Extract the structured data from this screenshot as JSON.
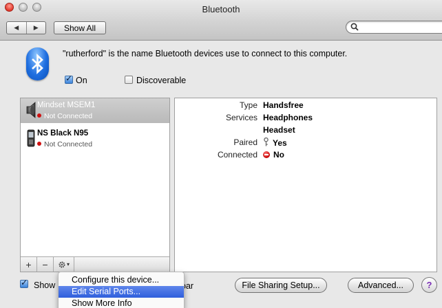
{
  "window": {
    "title": "Bluetooth"
  },
  "toolbar": {
    "back_symbol": "◀",
    "forward_symbol": "▶",
    "show_all": "Show All",
    "search_placeholder": ""
  },
  "header": {
    "description": "\"rutherford\" is the name Bluetooth devices use to connect to this computer.",
    "on_label": "On",
    "on_checked": true,
    "discoverable_label": "Discoverable",
    "discoverable_checked": false
  },
  "devices": [
    {
      "name": "Mindset MSEM1",
      "status": "Not Connected",
      "icon": "speaker-icon",
      "selected": true
    },
    {
      "name": "NS Black N95",
      "status": "Not Connected",
      "icon": "phone-icon",
      "selected": false
    }
  ],
  "list_bar": {
    "add": "+",
    "remove": "−",
    "gear_arrow": "▾"
  },
  "details": {
    "type_label": "Type",
    "type_value": "Handsfree",
    "services_label": "Services",
    "services_value_1": "Headphones",
    "services_value_2": "Headset",
    "paired_label": "Paired",
    "paired_value": "Yes",
    "connected_label": "Connected",
    "connected_value": "No"
  },
  "bottom": {
    "show_label": "Show",
    "bar_label": "bar",
    "show_checked": true,
    "file_sharing": "File Sharing Setup...",
    "advanced": "Advanced...",
    "help": "?"
  },
  "menu": {
    "items": [
      "Configure this device...",
      "Edit Serial Ports...",
      "Show More Info"
    ],
    "highlighted_index": 1
  },
  "colors": {
    "accent": "#2f5fdc",
    "status_red": "#d01010"
  }
}
